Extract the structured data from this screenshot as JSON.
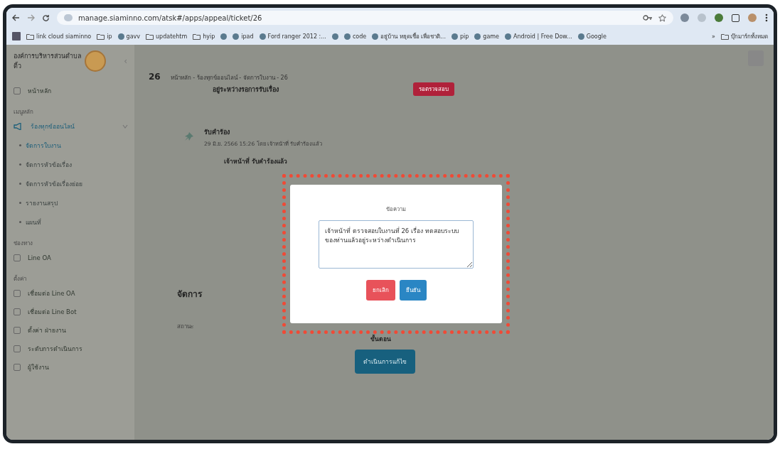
{
  "browser": {
    "url": "manage.siaminno.com/atsk#/apps/appeal/ticket/26",
    "bookmarks": [
      {
        "label": "link cloud siaminno",
        "kind": "folder"
      },
      {
        "label": "ip",
        "kind": "folder"
      },
      {
        "label": "gavv",
        "kind": "site"
      },
      {
        "label": "updatehtm",
        "kind": "folder"
      },
      {
        "label": "hyip",
        "kind": "folder"
      },
      {
        "kind": "site"
      },
      {
        "label": "ipad",
        "kind": "site"
      },
      {
        "label": "Ford ranger 2012 :...",
        "kind": "site"
      },
      {
        "kind": "site"
      },
      {
        "label": "code",
        "kind": "site"
      },
      {
        "label": "อยู่บ้าน หยุดเชื้อ เพื่อชาติ...",
        "kind": "site"
      },
      {
        "label": "pip",
        "kind": "site"
      },
      {
        "label": "game",
        "kind": "site"
      },
      {
        "label": "Android | Free Dow...",
        "kind": "site"
      },
      {
        "label": "Google",
        "kind": "site"
      }
    ],
    "more": "»",
    "other_bookmarks": "บุ๊กมาร์กทั้งหมด"
  },
  "sidebar": {
    "org_line1": "องค์การบริหารส่วนตำบล",
    "org_line2": "ติ้ว",
    "collapse": "‹",
    "items": [
      {
        "kind": "item",
        "label": "หน้าหลัก",
        "selected": false
      },
      {
        "kind": "section",
        "label": "เมนูหลัก"
      },
      {
        "kind": "group",
        "label": "ร้องทุกข์ออนไลน์",
        "expanded": true,
        "children": [
          {
            "label": "จัดการใบงาน",
            "selected": true
          },
          {
            "label": "จัดการหัวข้อเรื่อง",
            "selected": false
          },
          {
            "label": "จัดการหัวข้อเรื่องย่อย",
            "selected": false
          },
          {
            "label": "รายงานสรุป",
            "selected": false
          },
          {
            "label": "แผนที่",
            "selected": false
          }
        ]
      },
      {
        "kind": "section",
        "label": "ช่องทาง"
      },
      {
        "kind": "item",
        "label": "Line OA",
        "selected": false
      },
      {
        "kind": "section",
        "label": "ตั้งค่า"
      },
      {
        "kind": "item",
        "label": "เชื่อมต่อ Line OA",
        "selected": false
      },
      {
        "kind": "item",
        "label": "เชื่อมต่อ Line Bot",
        "selected": false
      },
      {
        "kind": "item",
        "label": "ตั้งค่า ฝ่ายงาน",
        "selected": false
      },
      {
        "kind": "item",
        "label": "ระดับการดำเนินการ",
        "selected": false
      },
      {
        "kind": "item",
        "label": "ผู้ใช้งาน",
        "selected": false
      }
    ]
  },
  "page": {
    "ticket_no": "26",
    "breadcrumb": "หน้าหลัก - ร้องทุกข์ออนไลน์ - จัดการใบงาน - 26",
    "status": "อยู่ระหว่างรอการรับเรื่อง",
    "badge": "รอตรวจสอบ",
    "timeline": {
      "title": "รับคำร้อง",
      "meta": "29 มิ.ย. 2566 15:26 โดย เจ้าหน้าที่ รับคำร้องแล้ว",
      "note": "เจ้าหน้าที่ รับคำร้องแล้ว"
    },
    "manage_title": "จัดการ",
    "field_label": "สถานะ",
    "step_label": "ขั้นตอน",
    "action_button": "ดำเนินการแก้ไข"
  },
  "modal": {
    "title": "ข้อความ",
    "message": "เจ้าหน้าที่ ตรวจสอบใบงานที่ 26 เรื่อง ทดสอบระบบ ของท่านแล้วอยู่ระหว่างดำเนินการ",
    "cancel": "ยกเลิก",
    "confirm": "ยืนยัน"
  }
}
